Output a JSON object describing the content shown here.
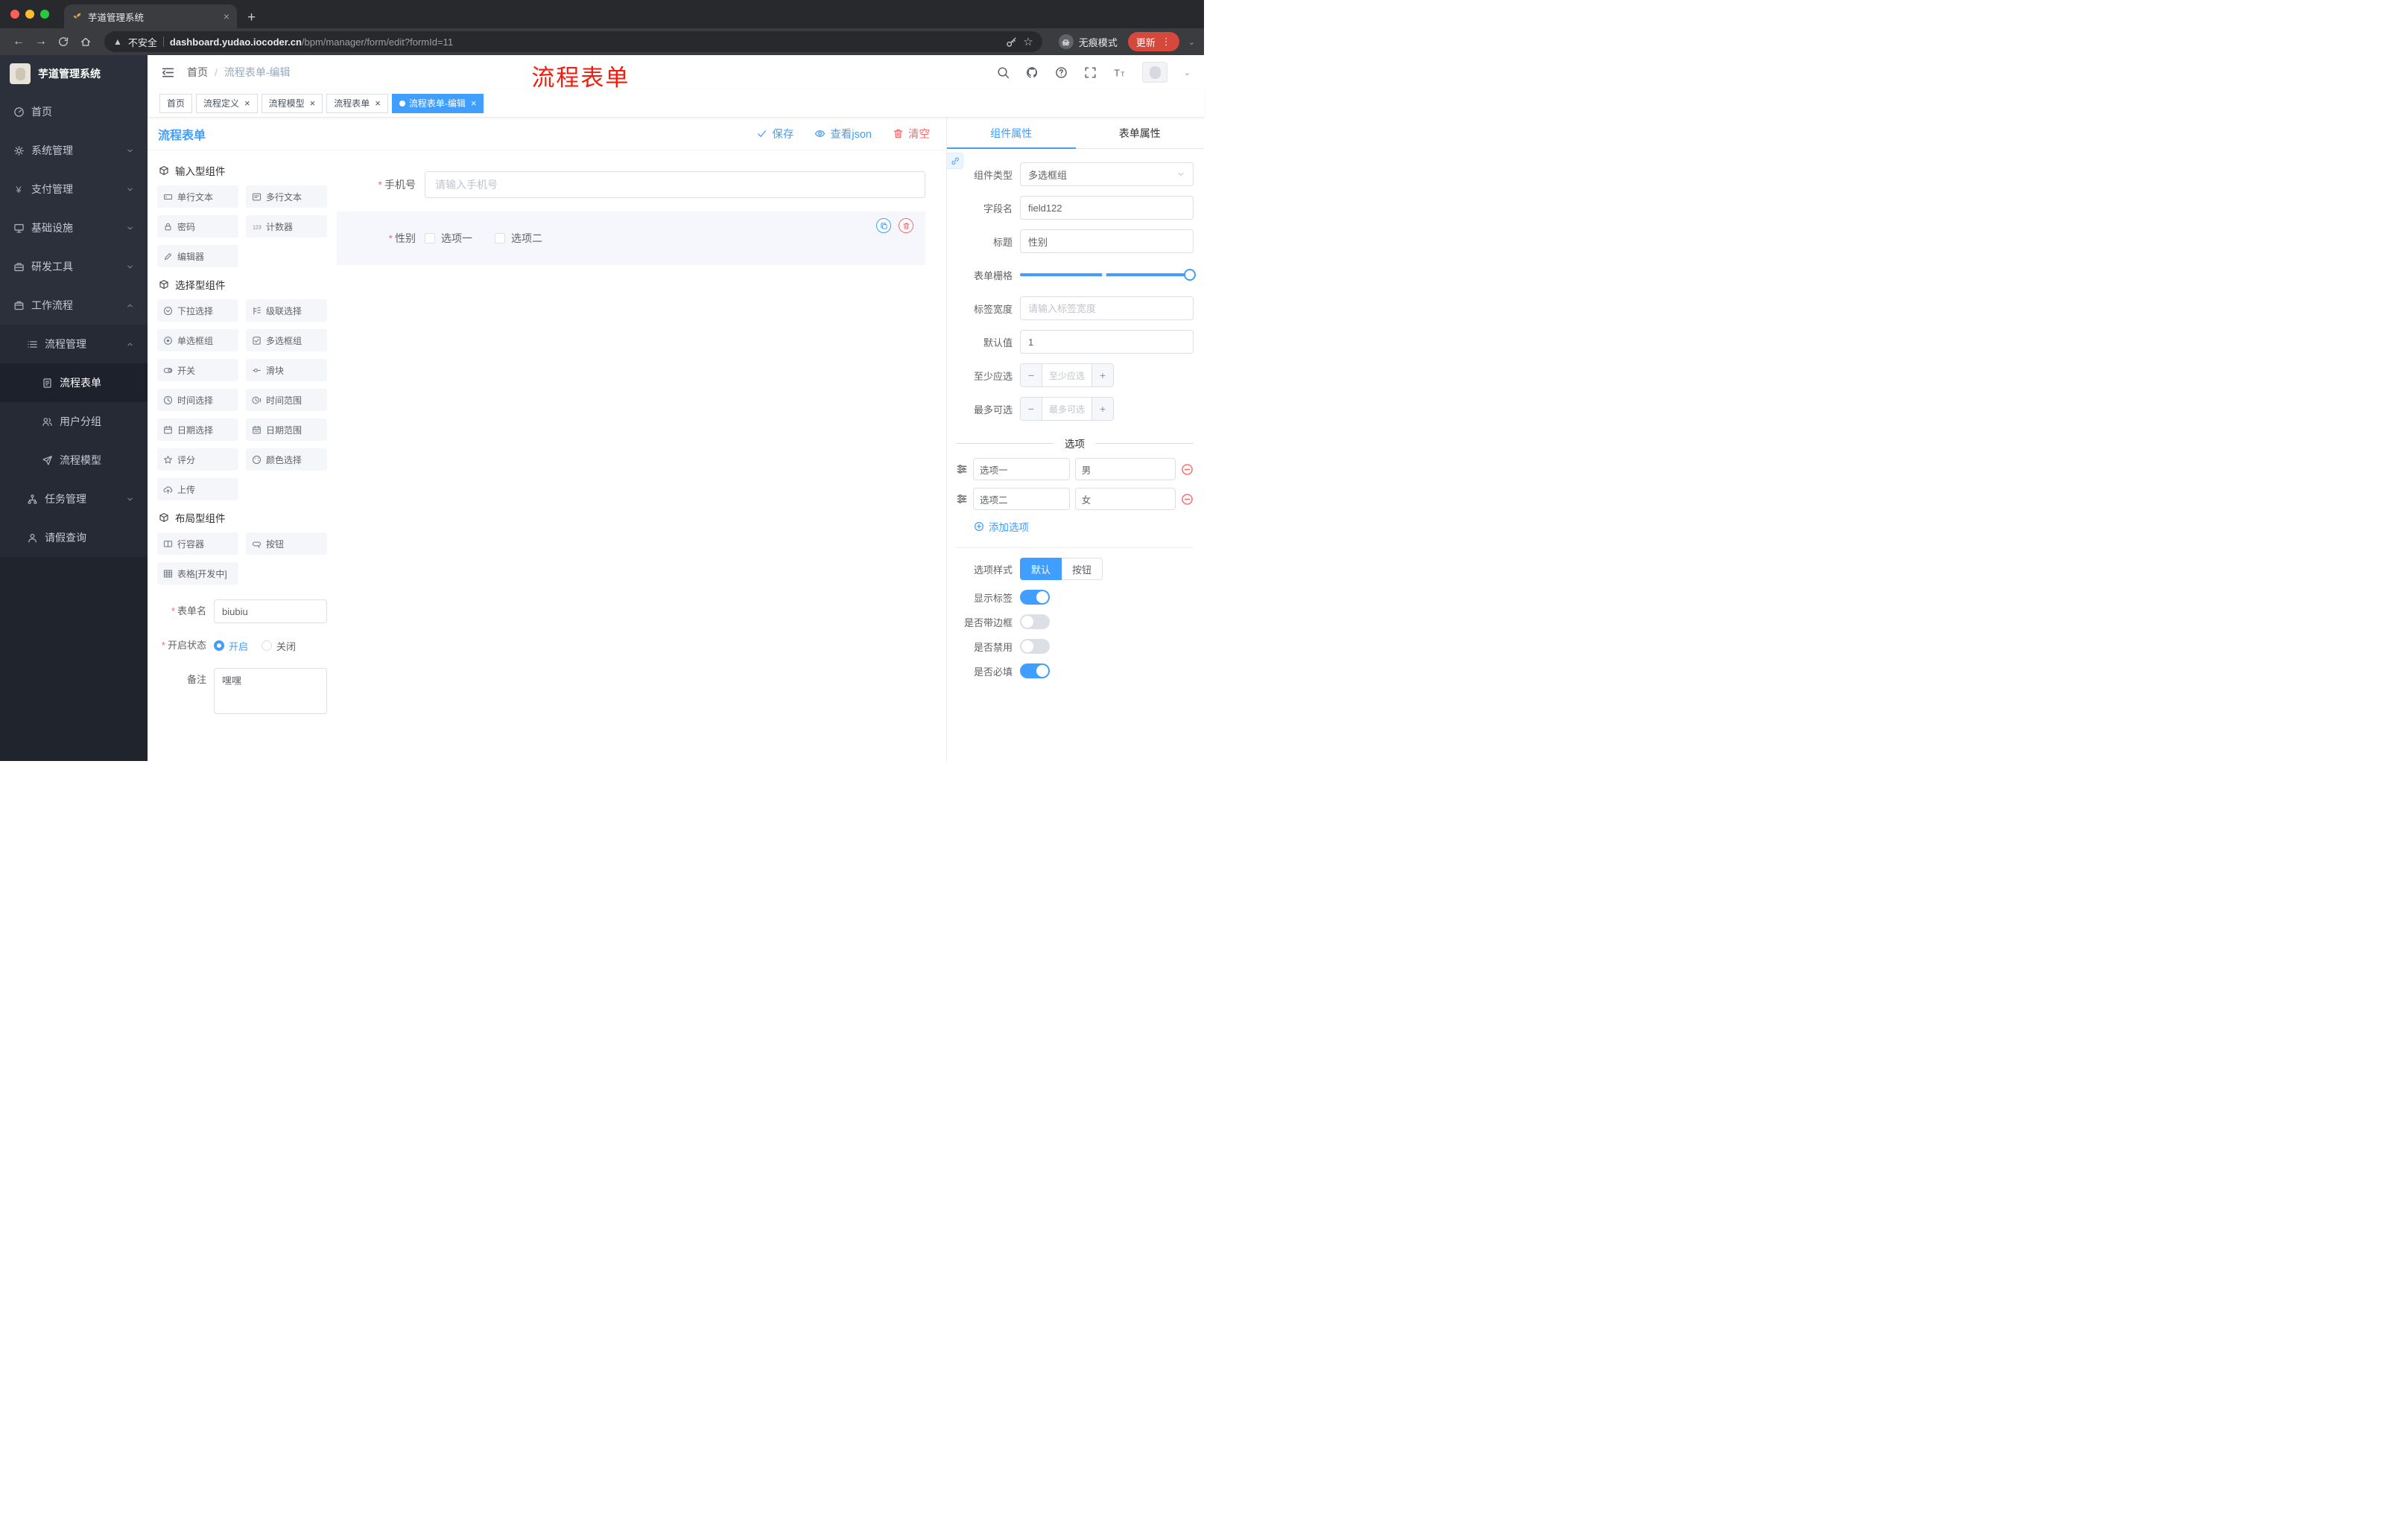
{
  "colors": {
    "accent": "#409eff",
    "danger": "#f56c6c",
    "annotation": "#f21b0c"
  },
  "browser": {
    "tab_title": "芋道管理系统",
    "security_label": "不安全",
    "url_domain": "dashboard.yudao.iocoder.cn",
    "url_path": "/bpm/manager/form/edit?formId=11",
    "incognito_label": "无痕模式",
    "update_label": "更新"
  },
  "sidebar": {
    "logo_title": "芋道管理系统",
    "items": [
      {
        "label": "首页",
        "key": "home",
        "icon": "gauge",
        "level": 1
      },
      {
        "label": "系统管理",
        "key": "system",
        "icon": "gear",
        "level": 1,
        "chevron": true
      },
      {
        "label": "支付管理",
        "key": "payment",
        "icon": "yen",
        "level": 1,
        "chevron": true
      },
      {
        "label": "基础设施",
        "key": "infrastructure",
        "icon": "infra",
        "level": 1,
        "chevron": true
      },
      {
        "label": "研发工具",
        "key": "dev-tools",
        "icon": "tools",
        "level": 1,
        "chevron": true
      },
      {
        "label": "工作流程",
        "key": "workflow",
        "icon": "workflow",
        "level": 1,
        "chevron": true,
        "open": true
      },
      {
        "label": "流程管理",
        "key": "process-management",
        "icon": "list",
        "level": 2,
        "chevron": true,
        "open": true
      },
      {
        "label": "流程表单",
        "key": "process-form",
        "icon": "doc",
        "level": 3,
        "active": true
      },
      {
        "label": "用户分组",
        "key": "user-group",
        "icon": "users",
        "level": 3
      },
      {
        "label": "流程模型",
        "key": "process-model",
        "icon": "send",
        "level": 3
      },
      {
        "label": "任务管理",
        "key": "task-management",
        "icon": "tree",
        "level": 2,
        "chevron": true
      },
      {
        "label": "请假查询",
        "key": "leave-query",
        "icon": "person",
        "level": 2
      }
    ]
  },
  "header": {
    "breadcrumb": [
      "首页",
      "流程表单-编辑"
    ],
    "annotation": "流程表单"
  },
  "tags": [
    {
      "label": "首页",
      "key": "home",
      "closable": false,
      "active": false
    },
    {
      "label": "流程定义",
      "key": "process-definition",
      "closable": true,
      "active": false
    },
    {
      "label": "流程模型",
      "key": "process-model",
      "closable": true,
      "active": false
    },
    {
      "label": "流程表单",
      "key": "process-form",
      "closable": true,
      "active": false
    },
    {
      "label": "流程表单-编辑",
      "key": "process-form-edit",
      "closable": true,
      "active": true
    }
  ],
  "designer": {
    "title": "流程表单",
    "toolbar": {
      "save": "保存",
      "view_json": "查看json",
      "clear": "清空"
    },
    "palette": {
      "groups": [
        {
          "title": "输入型组件",
          "key": "input-components",
          "items": [
            {
              "label": "单行文本",
              "key": "single-line-text",
              "icon": "input"
            },
            {
              "label": "多行文本",
              "key": "multi-line-text",
              "icon": "textarea"
            },
            {
              "label": "密码",
              "key": "password",
              "icon": "lock"
            },
            {
              "label": "计数器",
              "key": "counter",
              "icon": "counter"
            },
            {
              "label": "编辑器",
              "key": "editor",
              "icon": "editor"
            }
          ]
        },
        {
          "title": "选择型组件",
          "key": "select-components",
          "items": [
            {
              "label": "下拉选择",
              "key": "select",
              "icon": "select"
            },
            {
              "label": "级联选择",
              "key": "cascader",
              "icon": "cascader"
            },
            {
              "label": "单选框组",
              "key": "radio-group",
              "icon": "radio"
            },
            {
              "label": "多选框组",
              "key": "checkbox-group",
              "icon": "checkbox"
            },
            {
              "label": "开关",
              "key": "switch",
              "icon": "switch"
            },
            {
              "label": "滑块",
              "key": "slider",
              "icon": "slider"
            },
            {
              "label": "时间选择",
              "key": "time-picker",
              "icon": "time"
            },
            {
              "label": "时间范围",
              "key": "time-range",
              "icon": "timerange"
            },
            {
              "label": "日期选择",
              "key": "date-picker",
              "icon": "date"
            },
            {
              "label": "日期范围",
              "key": "date-range",
              "icon": "daterange"
            },
            {
              "label": "评分",
              "key": "rate",
              "icon": "star"
            },
            {
              "label": "颜色选择",
              "key": "color-picker",
              "icon": "color"
            },
            {
              "label": "上传",
              "key": "upload",
              "icon": "upload"
            }
          ]
        },
        {
          "title": "布局型组件",
          "key": "layout-components",
          "items": [
            {
              "label": "行容器",
              "key": "row-container",
              "icon": "row"
            },
            {
              "label": "按钮",
              "key": "button",
              "icon": "button"
            },
            {
              "label": "表格[开发中]",
              "key": "table",
              "icon": "table"
            }
          ]
        }
      ]
    },
    "form_meta": {
      "name_label": "表单名",
      "name_value": "biubiu",
      "status_label": "开启状态",
      "status_options": [
        "开启",
        "关闭"
      ],
      "status_value": "开启",
      "remark_label": "备注",
      "remark_value": "嘿嘿"
    },
    "canvas": {
      "fields": [
        {
          "label": "手机号",
          "required": true,
          "type": "input",
          "placeholder": "请输入手机号"
        },
        {
          "label": "性别",
          "required": true,
          "type": "checkbox-group",
          "options": [
            "选项一",
            "选项二"
          ],
          "selected": true
        }
      ]
    }
  },
  "properties": {
    "tabs": [
      "组件属性",
      "表单属性"
    ],
    "active_tab": "组件属性",
    "component_type_label": "组件类型",
    "component_type_value": "多选框组",
    "field_name_label": "字段名",
    "field_name_value": "field122",
    "title_label": "标题",
    "title_value": "性别",
    "grid_label": "表单栅格",
    "label_width_label": "标签宽度",
    "label_width_placeholder": "请输入标签宽度",
    "default_label": "默认值",
    "default_value": "1",
    "min_label": "至少应选",
    "min_placeholder": "至少应选",
    "max_label": "最多可选",
    "max_placeholder": "最多可选",
    "options_title": "选项",
    "options": [
      {
        "label": "选项一",
        "value": "男"
      },
      {
        "label": "选项二",
        "value": "女"
      }
    ],
    "add_option_label": "添加选项",
    "option_style_label": "选项样式",
    "option_styles": [
      "默认",
      "按钮"
    ],
    "option_style_value": "默认",
    "toggles": [
      {
        "key": "show-label",
        "label": "显示标签",
        "on": true
      },
      {
        "key": "border",
        "label": "是否带边框",
        "on": false
      },
      {
        "key": "disabled",
        "label": "是否禁用",
        "on": false
      },
      {
        "key": "required",
        "label": "是否必填",
        "on": true
      }
    ]
  }
}
